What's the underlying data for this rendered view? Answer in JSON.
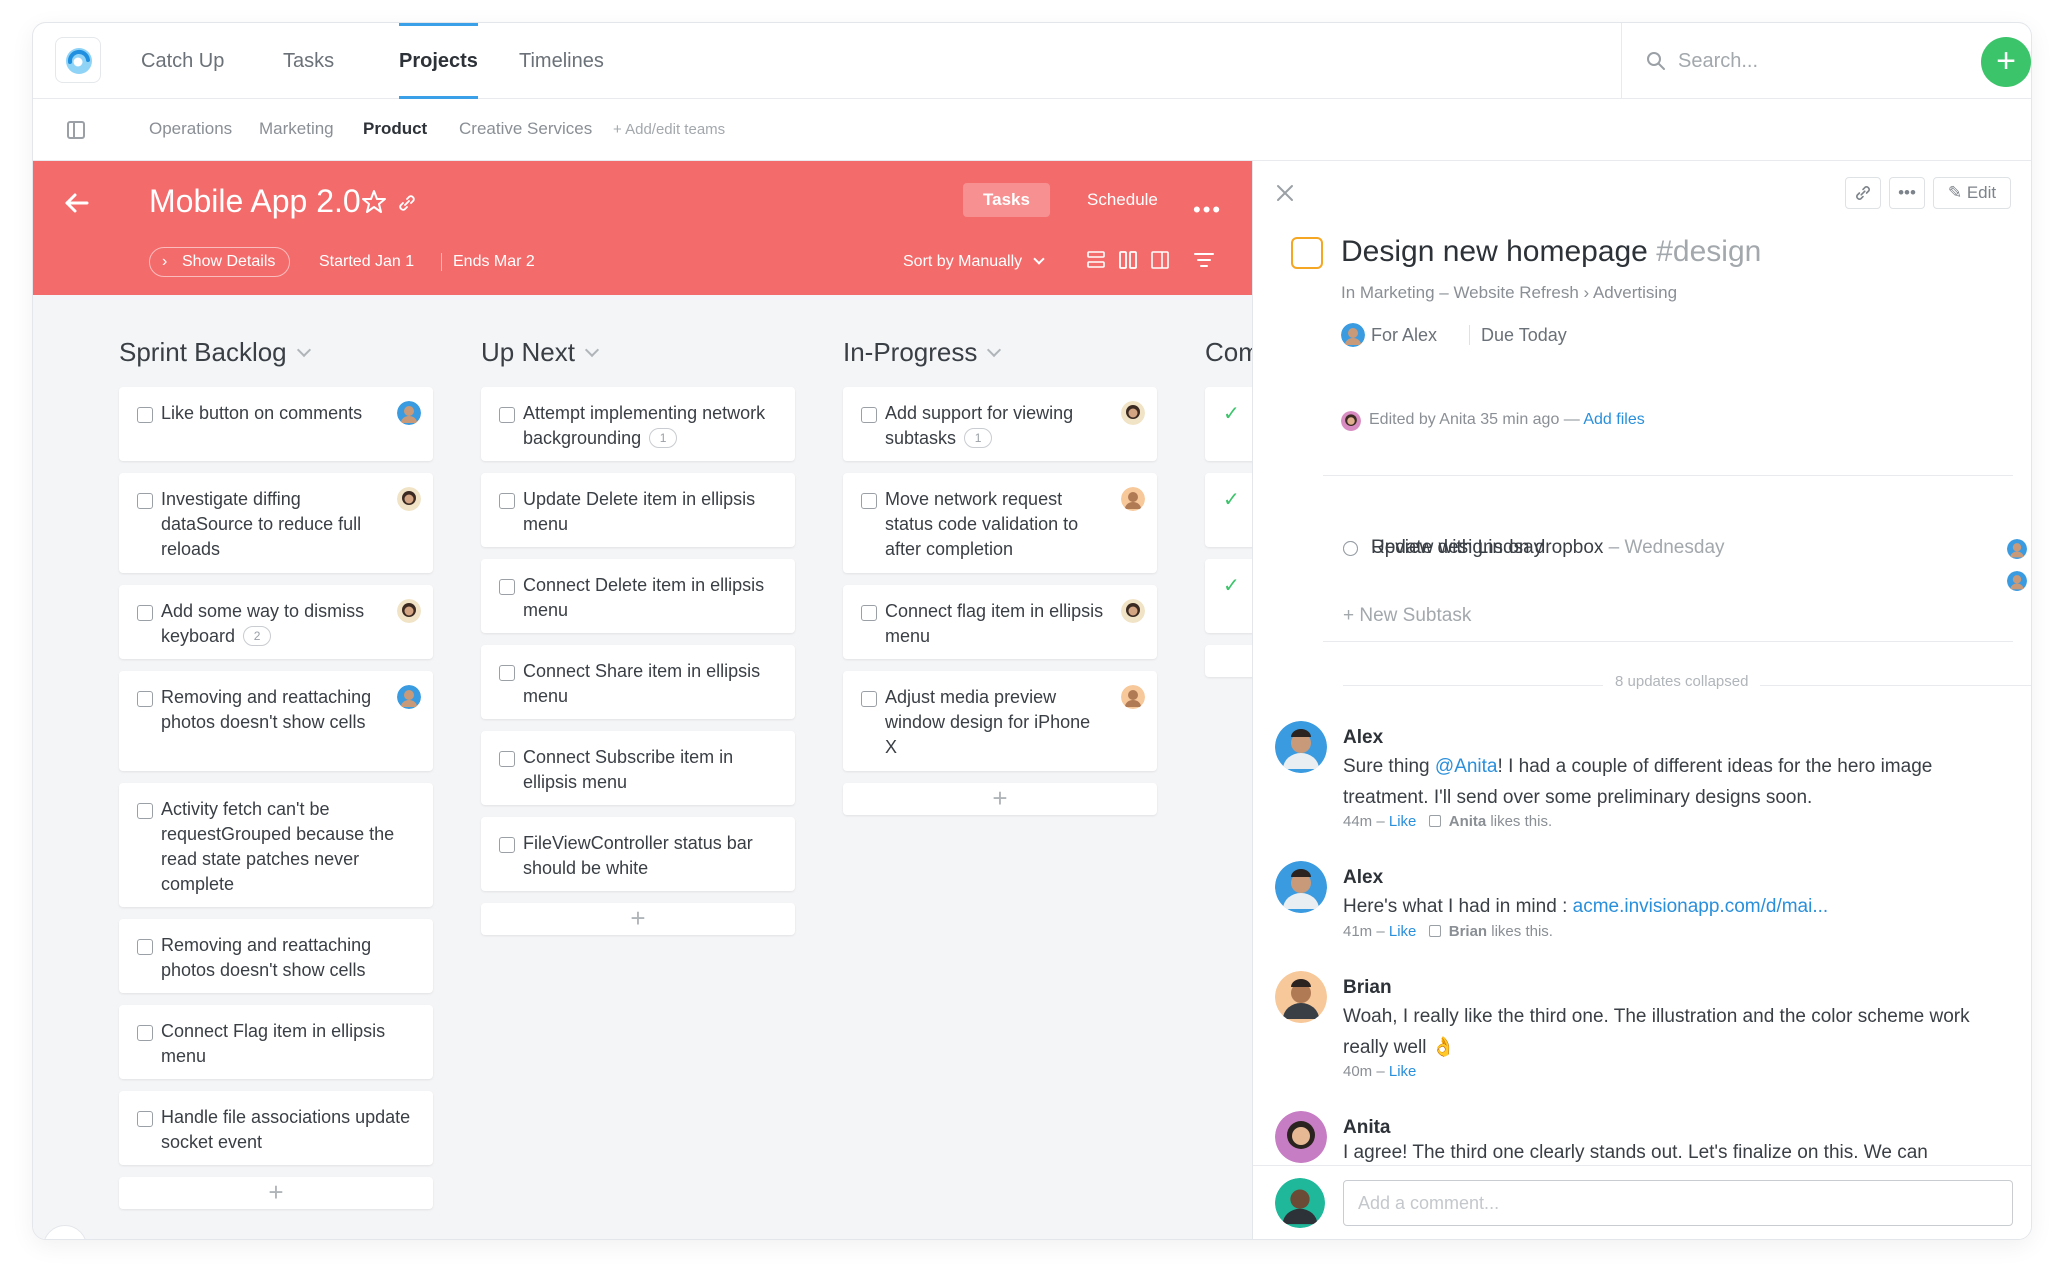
{
  "nav": {
    "tabs": [
      {
        "label": "Catch Up"
      },
      {
        "label": "Tasks"
      },
      {
        "label": "Projects"
      },
      {
        "label": "Timelines"
      }
    ],
    "active_tab": "Projects",
    "search_placeholder": "Search...",
    "add_label": "+"
  },
  "teams": {
    "items": [
      "Operations",
      "Marketing",
      "Product",
      "Creative Services"
    ],
    "active": "Product",
    "add_label": "+ Add/edit teams"
  },
  "project": {
    "title": "Mobile App 2.0",
    "view_tabs": [
      "Tasks",
      "Schedule"
    ],
    "active_view": "Tasks",
    "more_label": "•••",
    "show_details": "Show Details",
    "started": "Started Jan 1",
    "ends": "Ends Mar 2",
    "sort": "Sort by Manually",
    "header_color": "#f46b6b"
  },
  "columns": [
    {
      "title": "Sprint Backlog",
      "cards": [
        {
          "text": "Like button on comments",
          "avatar": "m-blue"
        },
        {
          "text": "Investigate diffing dataSource to reduce full reloads",
          "avatar": "f-dark"
        },
        {
          "text": "Add some way to dismiss keyboard",
          "badge": "2",
          "avatar": "f-dark"
        },
        {
          "text": "Removing and reattaching photos doesn't show cells",
          "avatar": "m-blue"
        },
        {
          "text": "Activity fetch can't be requestGrouped because the read state patches never complete"
        },
        {
          "text": "Removing and reattaching photos doesn't show cells"
        },
        {
          "text": "Connect Flag item in ellipsis menu"
        },
        {
          "text": "Handle file associations update socket event"
        }
      ]
    },
    {
      "title": "Up Next",
      "cards": [
        {
          "text": "Attempt implementing network backgrounding",
          "badge": "1"
        },
        {
          "text": "Update Delete item in ellipsis menu"
        },
        {
          "text": "Connect Delete item in ellipsis menu"
        },
        {
          "text": "Connect Share item in ellipsis menu"
        },
        {
          "text": "Connect Subscribe item in ellipsis menu"
        },
        {
          "text": "FileViewController status bar should be white"
        }
      ]
    },
    {
      "title": "In-Progress",
      "cards": [
        {
          "text": "Add support for viewing subtasks",
          "badge": "1",
          "avatar": "f-dark"
        },
        {
          "text": "Move network request status code validation to after completion",
          "avatar": "m-orange"
        },
        {
          "text": "Connect flag item in ellipsis menu",
          "avatar": "f-dark"
        },
        {
          "text": "Adjust media preview window design for iPhone X",
          "avatar": "m-orange"
        }
      ]
    },
    {
      "title": "Com",
      "cards": [
        {
          "check": true
        },
        {
          "check": true
        },
        {
          "check": true
        },
        {}
      ]
    }
  ],
  "add_card_label": "+",
  "detail": {
    "more_label": "•••",
    "edit_label": "Edit",
    "title": "Design new homepage",
    "tag": "#design",
    "breadcrumb": "In Marketing – Website Refresh › Advertising",
    "for": "For Alex",
    "due": "Due Today",
    "edited_prefix": "Edited by Anita 35 min ago —",
    "add_files": "Add files",
    "subtasks": [
      {
        "text": "Update designs on dropbox",
        "due": "– Wednesday"
      },
      {
        "text": "Review with Lindsay",
        "due": ""
      }
    ],
    "new_subtask": "+   New Subtask",
    "collapsed": "8 updates collapsed",
    "comments": [
      {
        "author": "Alex",
        "pre": "Sure thing ",
        "mention": "@Anita",
        "body": "! I had a couple of different ideas for the hero image treatment. I'll send over some preliminary designs soon.",
        "time": "44m –",
        "like": "Like",
        "liker": "Anita",
        "likes_suffix": "likes this."
      },
      {
        "author": "Alex",
        "pre": "Here's what I had in mind : ",
        "link": "acme.invisionapp.com/d/mai...",
        "time": "41m –",
        "like": "Like",
        "liker": "Brian",
        "likes_suffix": "likes this."
      },
      {
        "author": "Brian",
        "body": "Woah, I really like the third one. The illustration and the color scheme work really well 👌",
        "time": "40m –",
        "like": "Like"
      },
      {
        "author": "Anita",
        "body": "I agree! The third one clearly stands out. Let's finalize on this. We can"
      }
    ],
    "comment_placeholder": "Add a comment..."
  }
}
